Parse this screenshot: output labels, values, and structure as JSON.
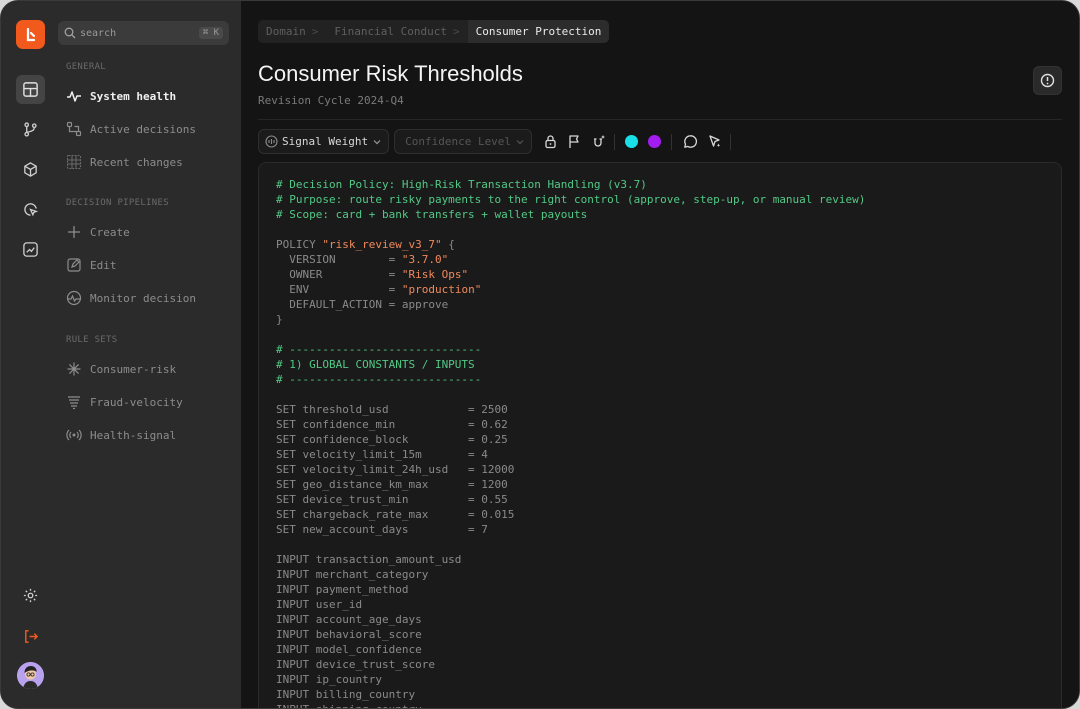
{
  "search": {
    "placeholder": "search",
    "shortcut": "⌘ K"
  },
  "sidebar": {
    "sections": [
      {
        "title": "GENERAL",
        "items": [
          {
            "label": "System health",
            "icon": "pulse-icon",
            "active": true
          },
          {
            "label": "Active decisions",
            "icon": "workflow-icon"
          },
          {
            "label": "Recent changes",
            "icon": "calendar-grid-icon"
          }
        ]
      },
      {
        "title": "DECISION PIPELINES",
        "items": [
          {
            "label": "Create",
            "icon": "plus-icon"
          },
          {
            "label": "Edit",
            "icon": "edit-icon"
          },
          {
            "label": "Monitor decision",
            "icon": "monitor-pulse-icon"
          }
        ]
      },
      {
        "title": "RULE SETS",
        "items": [
          {
            "label": "Consumer-risk",
            "icon": "asterisk-icon"
          },
          {
            "label": "Fraud-velocity",
            "icon": "layers-icon"
          },
          {
            "label": "Health-signal",
            "icon": "broadcast-icon"
          }
        ]
      }
    ]
  },
  "breadcrumb": [
    "Domain",
    "Financial Conduct",
    "Consumer Protection"
  ],
  "page": {
    "title": "Consumer Risk Thresholds",
    "subtitle": "Revision Cycle 2024-Q4"
  },
  "toolbar": {
    "signal_select": "Signal Weight",
    "confidence_select": "Confidence Level",
    "colors": [
      "#19e0e6",
      "#a31cf0"
    ]
  },
  "code_lines": [
    [
      [
        "c",
        "# Decision Policy: High-Risk Transaction Handling (v3.7)"
      ]
    ],
    [
      [
        "c",
        "# Purpose: route risky payments to the right control (approve, step-up, or manual review)"
      ]
    ],
    [
      [
        "c",
        "# Scope: card + bank transfers + wallet payouts"
      ]
    ],
    [],
    [
      [
        "t",
        "POLICY "
      ],
      [
        "s",
        "\"risk_review_v3_7\""
      ],
      [
        "t",
        " {"
      ]
    ],
    [
      [
        "t",
        "  VERSION        = "
      ],
      [
        "s",
        "\"3.7.0\""
      ]
    ],
    [
      [
        "t",
        "  OWNER          = "
      ],
      [
        "s",
        "\"Risk Ops\""
      ]
    ],
    [
      [
        "t",
        "  ENV            = "
      ],
      [
        "s",
        "\"production\""
      ]
    ],
    [
      [
        "t",
        "  DEFAULT_ACTION = approve"
      ]
    ],
    [
      [
        "t",
        "}"
      ]
    ],
    [],
    [
      [
        "c",
        "# -----------------------------"
      ]
    ],
    [
      [
        "c",
        "# 1) GLOBAL CONSTANTS / INPUTS"
      ]
    ],
    [
      [
        "c",
        "# -----------------------------"
      ]
    ],
    [],
    [
      [
        "t",
        "SET threshold_usd            = 2500"
      ]
    ],
    [
      [
        "t",
        "SET confidence_min           = 0.62"
      ]
    ],
    [
      [
        "t",
        "SET confidence_block         = 0.25"
      ]
    ],
    [
      [
        "t",
        "SET velocity_limit_15m       = 4"
      ]
    ],
    [
      [
        "t",
        "SET velocity_limit_24h_usd   = 12000"
      ]
    ],
    [
      [
        "t",
        "SET geo_distance_km_max      = 1200"
      ]
    ],
    [
      [
        "t",
        "SET device_trust_min         = 0.55"
      ]
    ],
    [
      [
        "t",
        "SET chargeback_rate_max      = 0.015"
      ]
    ],
    [
      [
        "t",
        "SET new_account_days         = 7"
      ]
    ],
    [],
    [
      [
        "t",
        "INPUT transaction_amount_usd"
      ]
    ],
    [
      [
        "t",
        "INPUT merchant_category"
      ]
    ],
    [
      [
        "t",
        "INPUT payment_method"
      ]
    ],
    [
      [
        "t",
        "INPUT user_id"
      ]
    ],
    [
      [
        "t",
        "INPUT account_age_days"
      ]
    ],
    [
      [
        "t",
        "INPUT behavioral_score"
      ]
    ],
    [
      [
        "t",
        "INPUT model_confidence"
      ]
    ],
    [
      [
        "t",
        "INPUT device_trust_score"
      ]
    ],
    [
      [
        "t",
        "INPUT ip_country"
      ]
    ],
    [
      [
        "t",
        "INPUT billing_country"
      ]
    ],
    [
      [
        "t",
        "INPUT shipping_country"
      ]
    ]
  ]
}
